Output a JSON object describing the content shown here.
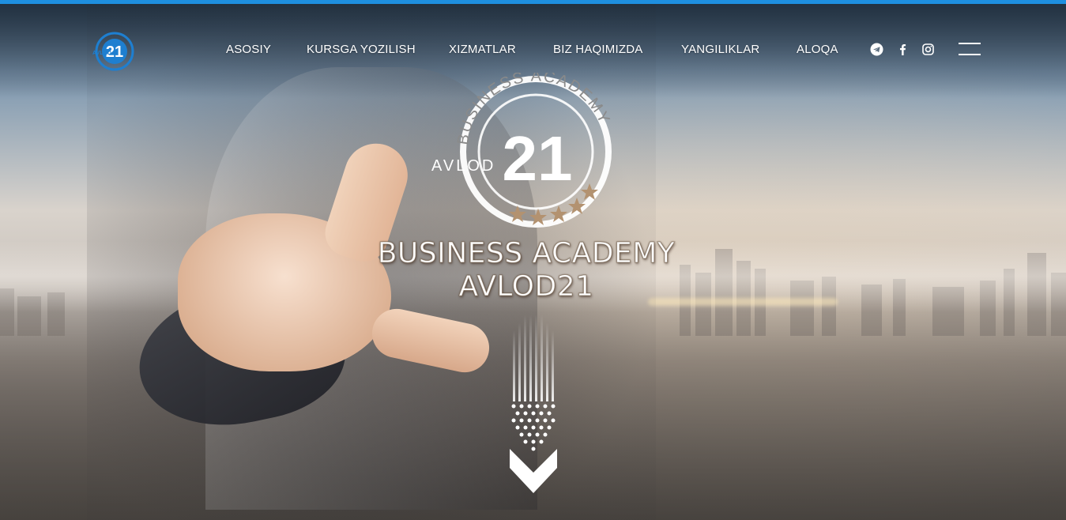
{
  "brand": {
    "logo_number": "21",
    "logo_word": "AVLOD",
    "logo_ring_text": "BUSINESS ACADEMY",
    "accent_color": "#1e8fe0"
  },
  "nav": {
    "items": [
      {
        "label": "ASOSIY"
      },
      {
        "label": "KURSGA YOZILISH"
      },
      {
        "label": "XIZMATLAR"
      },
      {
        "label": "BIZ HAQIMIZDA"
      },
      {
        "label": "YANGILIKLAR"
      },
      {
        "label": "ALOQA"
      }
    ]
  },
  "social": [
    {
      "icon": "telegram-icon"
    },
    {
      "icon": "facebook-icon"
    },
    {
      "icon": "instagram-icon"
    }
  ],
  "hero": {
    "emblem_ring_text": "BUSINESS ACADEMY",
    "emblem_word": "AVLOD",
    "emblem_number": "21",
    "title_line1": "BUSINESS ACADEMY",
    "title_line2": "AVLOD21"
  }
}
